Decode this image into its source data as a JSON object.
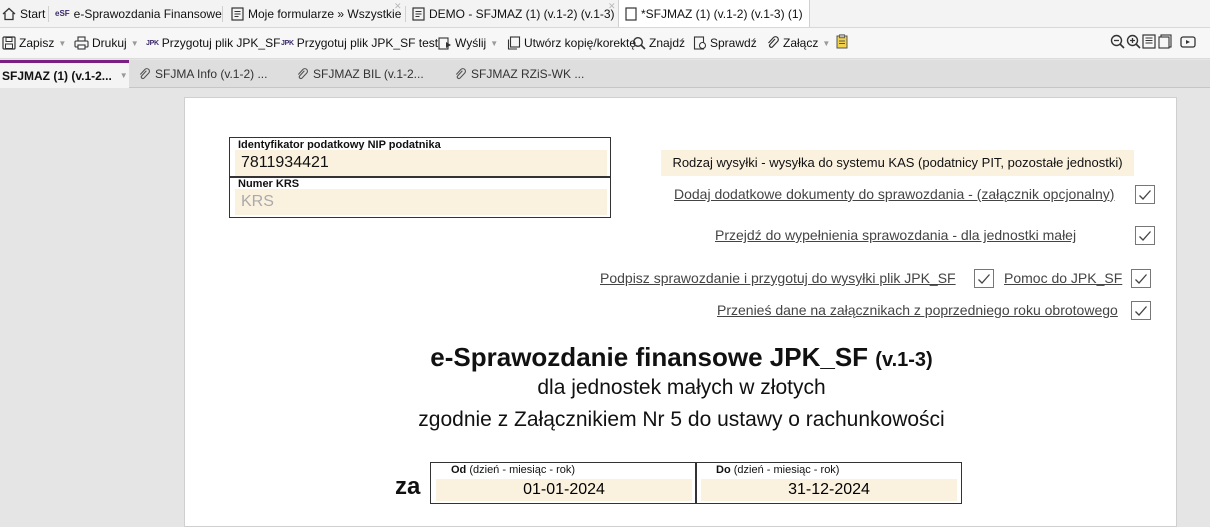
{
  "tabs": {
    "start": "Start",
    "esf": "e-Sprawozdania Finansowe",
    "esf_badge": "eSF",
    "moje": "Moje formularze » Wszystkie",
    "demo": "DEMO - SFJMAZ (1) (v.1-2) (v.1-3)",
    "current": "*SFJMAZ (1) (v.1-2) (v.1-3) (1)"
  },
  "toolbar": {
    "zapisz": "Zapisz",
    "drukuj": "Drukuj",
    "jpk_badge": "JPK",
    "przygotuj": "Przygotuj plik JPK_SF",
    "przygotuj_test": "Przygotuj plik JPK_SF test",
    "wyslij": "Wyślij",
    "utworz": "Utwórz kopię/korektę",
    "znajdz": "Znajdź",
    "sprawdz": "Sprawdź",
    "zalacz": "Załącz"
  },
  "subtabs": [
    "SFJMAZ (1) (v.1-2...",
    "SFJMA Info (v.1-2) ...",
    "SFJMAZ BIL (v.1-2...",
    "SFJMAZ RZiS-WK ..."
  ],
  "form": {
    "nip_label": "Identyfikator podatkowy NIP podatnika",
    "nip_value": "7811934421",
    "krs_label": "Numer KRS",
    "krs_placeholder": "KRS",
    "rodzaj": "Rodzaj wysyłki - wysyłka do systemu KAS (podatnicy PIT, pozostałe jednostki)",
    "link_dodaj": "Dodaj dodatkowe dokumenty do sprawozdania - (załącznik opcjonalny)",
    "link_przejdz": "Przejdź do wypełnienia sprawozdania - dla jednostki małej",
    "link_podpisz": "Podpisz sprawozdanie i przygotuj do wysyłki plik JPK_SF",
    "link_pomoc": "Pomoc do JPK_SF",
    "link_przenies": "Przenieś dane na załącznikach z poprzedniego roku obrotowego",
    "title": "e-Sprawozdanie finansowe JPK_SF",
    "title_version": "(v.1-3)",
    "subtitle1": "dla jednostek małych w złotych",
    "subtitle2": "zgodnie z Załącznikiem Nr 5 do ustawy o rachunkowości",
    "za": "za",
    "od_label": "Od",
    "od_hint": "(dzień - miesiąc - rok)",
    "od_value": "01-01-2024",
    "do_label": "Do",
    "do_hint": "(dzień - miesiąc - rok)",
    "do_value": "31-12-2024"
  },
  "colors": {
    "accent": "#7a1e84",
    "field_bg": "#fbf1df",
    "page_bg": "#e5e5e5"
  }
}
